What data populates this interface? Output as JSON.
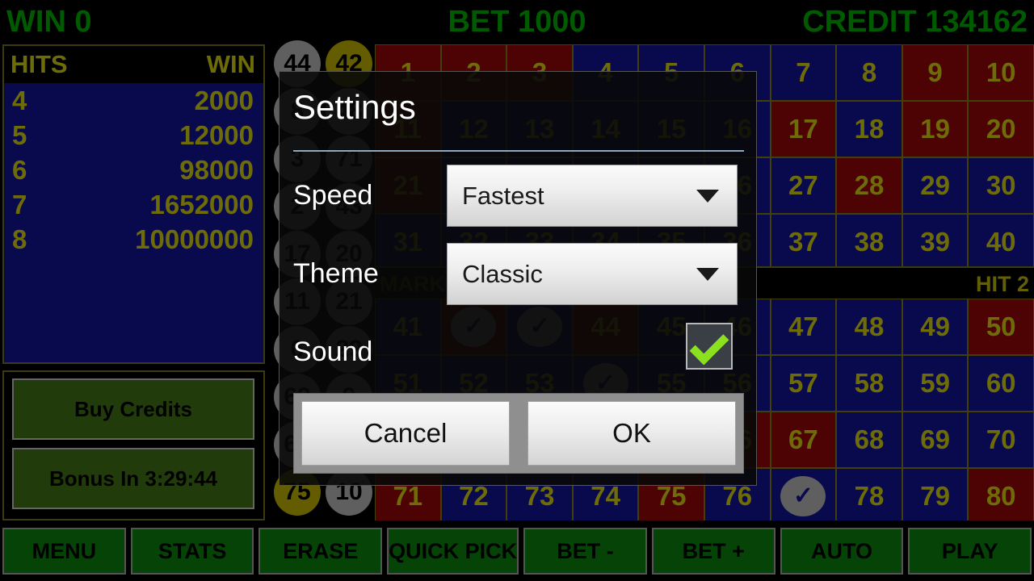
{
  "topbar": {
    "win": "WIN 0",
    "bet": "BET 1000",
    "credit": "CREDIT 134162",
    "color": "#00a400"
  },
  "paytable": {
    "header_hits": "HITS",
    "header_win": "WIN",
    "rows": [
      {
        "hits": "4",
        "win": "2000"
      },
      {
        "hits": "5",
        "win": "12000"
      },
      {
        "hits": "6",
        "win": "98000"
      },
      {
        "hits": "7",
        "win": "1652000"
      },
      {
        "hits": "8",
        "win": "10000000"
      }
    ]
  },
  "left_buttons": {
    "buy_credits": "Buy Credits",
    "bonus": "Bonus In 3:29:44"
  },
  "balls": [
    {
      "value": "44",
      "style": "gray"
    },
    {
      "value": "42",
      "style": "gold"
    },
    {
      "value": "8",
      "style": "gray"
    },
    {
      "value": "48",
      "style": "gray"
    },
    {
      "value": "3",
      "style": "gray"
    },
    {
      "value": "71",
      "style": "gray"
    },
    {
      "value": "2",
      "style": "gray"
    },
    {
      "value": "43",
      "style": "gray"
    },
    {
      "value": "17",
      "style": "gray"
    },
    {
      "value": "20",
      "style": "gray"
    },
    {
      "value": "11",
      "style": "gray"
    },
    {
      "value": "21",
      "style": "gray"
    },
    {
      "value": "6",
      "style": "gray"
    },
    {
      "value": "29",
      "style": "gray"
    },
    {
      "value": "62",
      "style": "gray"
    },
    {
      "value": "9",
      "style": "gray"
    },
    {
      "value": "63",
      "style": "gray"
    },
    {
      "value": "65",
      "style": "gray"
    },
    {
      "value": "75",
      "style": "gold"
    },
    {
      "value": "10",
      "style": "gray"
    }
  ],
  "board": {
    "mark_label": "MARK 8 SPOTS",
    "hit_label": "HIT 2",
    "top_cells": [
      {
        "n": "1",
        "marked": true
      },
      {
        "n": "2",
        "marked": true
      },
      {
        "n": "3",
        "marked": true
      },
      {
        "n": "4",
        "marked": false
      },
      {
        "n": "5",
        "marked": false
      },
      {
        "n": "6",
        "marked": false
      },
      {
        "n": "7",
        "marked": false
      },
      {
        "n": "8",
        "marked": false
      },
      {
        "n": "9",
        "marked": true
      },
      {
        "n": "10",
        "marked": true
      },
      {
        "n": "11",
        "marked": true
      },
      {
        "n": "12",
        "marked": false
      },
      {
        "n": "13",
        "marked": false
      },
      {
        "n": "14",
        "marked": false
      },
      {
        "n": "15",
        "marked": false
      },
      {
        "n": "16",
        "marked": false
      },
      {
        "n": "17",
        "marked": true
      },
      {
        "n": "18",
        "marked": false
      },
      {
        "n": "19",
        "marked": true
      },
      {
        "n": "20",
        "marked": true
      },
      {
        "n": "21",
        "marked": true
      },
      {
        "n": "22",
        "marked": false
      },
      {
        "n": "23",
        "marked": false
      },
      {
        "n": "24",
        "marked": false
      },
      {
        "n": "25",
        "marked": false
      },
      {
        "n": "26",
        "marked": false
      },
      {
        "n": "27",
        "marked": false
      },
      {
        "n": "28",
        "marked": true
      },
      {
        "n": "29",
        "marked": false
      },
      {
        "n": "30",
        "marked": false
      },
      {
        "n": "31",
        "marked": false
      },
      {
        "n": "32",
        "marked": false
      },
      {
        "n": "33",
        "marked": false
      },
      {
        "n": "34",
        "marked": false
      },
      {
        "n": "35",
        "marked": false
      },
      {
        "n": "36",
        "marked": false
      },
      {
        "n": "37",
        "marked": false
      },
      {
        "n": "38",
        "marked": false
      },
      {
        "n": "39",
        "marked": false
      },
      {
        "n": "40",
        "marked": false
      }
    ],
    "bottom_cells": [
      {
        "n": "41",
        "marked": false
      },
      {
        "n": "42",
        "marked": true,
        "hit": true
      },
      {
        "n": "43",
        "marked": false,
        "hit": true
      },
      {
        "n": "44",
        "marked": true
      },
      {
        "n": "45",
        "marked": false
      },
      {
        "n": "46",
        "marked": false
      },
      {
        "n": "47",
        "marked": false
      },
      {
        "n": "48",
        "marked": false
      },
      {
        "n": "49",
        "marked": false
      },
      {
        "n": "50",
        "marked": true
      },
      {
        "n": "51",
        "marked": false
      },
      {
        "n": "52",
        "marked": false
      },
      {
        "n": "53",
        "marked": false
      },
      {
        "n": "54",
        "marked": false,
        "hit": true
      },
      {
        "n": "55",
        "marked": false
      },
      {
        "n": "56",
        "marked": false
      },
      {
        "n": "57",
        "marked": false
      },
      {
        "n": "58",
        "marked": false
      },
      {
        "n": "59",
        "marked": false
      },
      {
        "n": "60",
        "marked": false
      },
      {
        "n": "61",
        "marked": false
      },
      {
        "n": "62",
        "marked": false
      },
      {
        "n": "63",
        "marked": false
      },
      {
        "n": "64",
        "marked": false
      },
      {
        "n": "65",
        "marked": false
      },
      {
        "n": "66",
        "marked": true
      },
      {
        "n": "67",
        "marked": true
      },
      {
        "n": "68",
        "marked": false
      },
      {
        "n": "69",
        "marked": false
      },
      {
        "n": "70",
        "marked": false
      },
      {
        "n": "71",
        "marked": true
      },
      {
        "n": "72",
        "marked": false
      },
      {
        "n": "73",
        "marked": false
      },
      {
        "n": "74",
        "marked": false
      },
      {
        "n": "75",
        "marked": true
      },
      {
        "n": "76",
        "marked": false
      },
      {
        "n": "77",
        "marked": false,
        "hit": true
      },
      {
        "n": "78",
        "marked": false
      },
      {
        "n": "79",
        "marked": false
      },
      {
        "n": "80",
        "marked": true
      }
    ]
  },
  "bottom_buttons": [
    "MENU",
    "STATS",
    "ERASE",
    "QUICK PICK",
    "BET -",
    "BET +",
    "AUTO",
    "PLAY"
  ],
  "dialog": {
    "title": "Settings",
    "speed_label": "Speed",
    "speed_value": "Fastest",
    "theme_label": "Theme",
    "theme_value": "Classic",
    "sound_label": "Sound",
    "sound_checked": true,
    "cancel_label": "Cancel",
    "ok_label": "OK"
  }
}
